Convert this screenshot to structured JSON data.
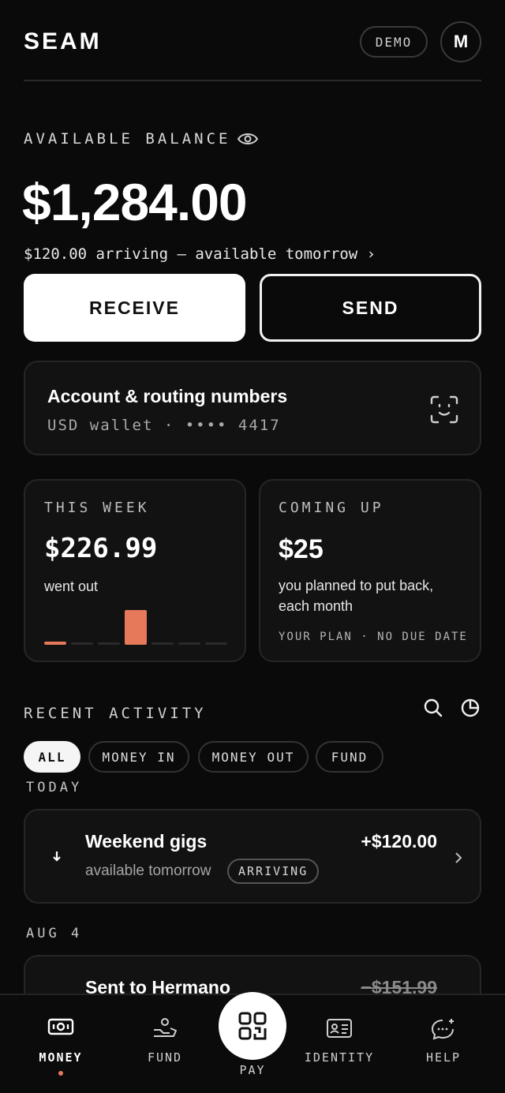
{
  "header": {
    "logo": "SEAM",
    "demo_label": "DEMO",
    "avatar_initial": "M"
  },
  "balance": {
    "label": "AVAILABLE BALANCE",
    "amount": "$1,284.00",
    "arriving": "$120.00 arriving — available tomorrow ›"
  },
  "actions": {
    "receive": "RECEIVE",
    "send": "SEND"
  },
  "account": {
    "title": "Account & routing numbers",
    "subtitle": "USD wallet · •••• 4417"
  },
  "this_week": {
    "caption": "THIS WEEK",
    "amount": "$226.99",
    "note": "went out",
    "bars": [
      0.08,
      0.05,
      0.05,
      1.0,
      0.05,
      0.05,
      0.05
    ],
    "highlight_index": 3
  },
  "coming_up": {
    "caption": "COMING UP",
    "amount": "$25",
    "note": "you planned to put back, each month",
    "footnote": "YOUR PLAN · NO DUE DATE"
  },
  "activity": {
    "label": "RECENT ACTIVITY",
    "filters": [
      "ALL",
      "MONEY IN",
      "MONEY OUT",
      "FUND"
    ],
    "today_label": "TODAY",
    "tx1": {
      "title": "Weekend gigs",
      "amount": "+$120.00",
      "sub": "available tomorrow",
      "badge": "ARRIVING"
    },
    "aug_label": "AUG 4",
    "tx2": {
      "title": "Sent to Hermano",
      "amount": "−$151.99"
    }
  },
  "nav": {
    "money": "MONEY",
    "fund": "FUND",
    "pay": "PAY",
    "identity": "IDENTITY",
    "help": "HELP"
  },
  "colors": {
    "accent": "#e5795a",
    "background": "#0a0a0a",
    "card": "#121212"
  }
}
